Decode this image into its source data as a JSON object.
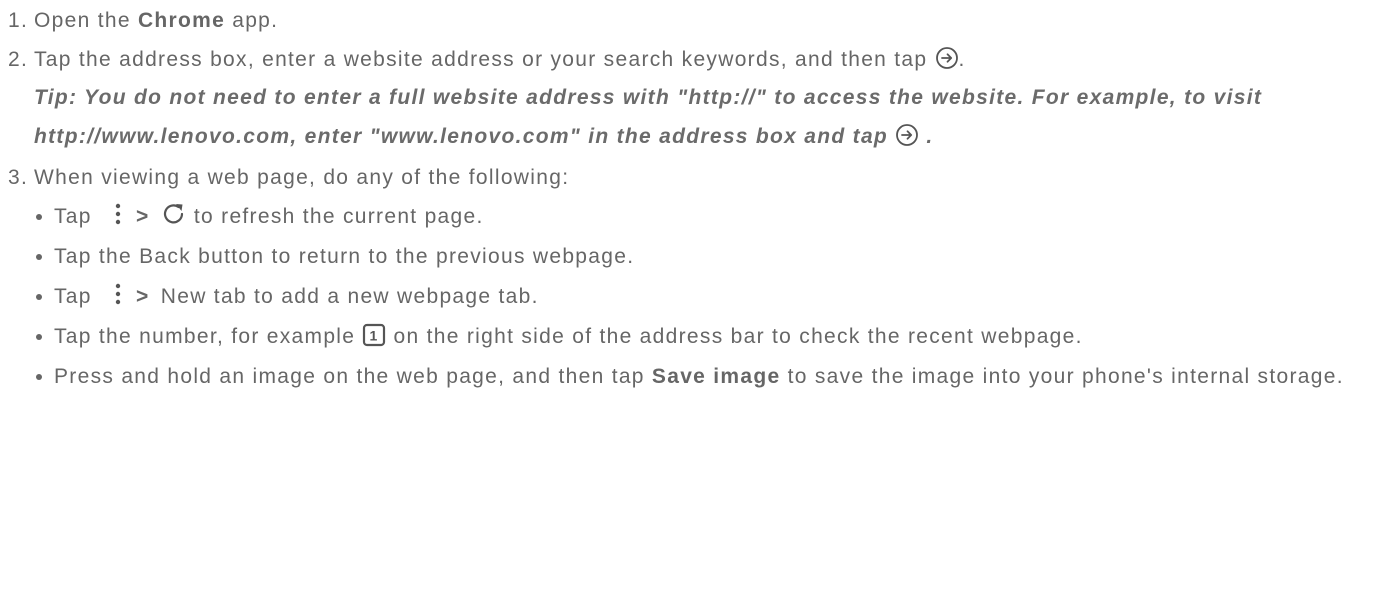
{
  "steps": [
    {
      "num": "1.",
      "pre": "Open the ",
      "bold": "Chrome",
      "post": " app."
    },
    {
      "num": "2.",
      "pre": "Tap the address box, enter a website address or your search keywords, and then tap",
      "post": "."
    },
    {
      "num": "3.",
      "text": "When viewing a web page, do any of the following:"
    }
  ],
  "tip": {
    "text": "Tip: You do not need to enter a full website address with \"http://\" to access the website. For example, to visit http://www.lenovo.com, enter \"www.lenovo.com\" in the address box and tap",
    "end": " ."
  },
  "bullets": {
    "refresh": {
      "pre": "Tap",
      "sep": ">",
      "post": "to refresh the current page."
    },
    "back": {
      "text": "Tap the Back button to return to the previous webpage."
    },
    "newtab": {
      "pre": "Tap",
      "sep": ">",
      "post": "New tab to add a new webpage tab."
    },
    "tabs": {
      "pre": "Tap the number, for example",
      "badge": "1",
      "post": "on the right side of the address bar to check the recent webpage."
    },
    "save": {
      "pre": "Press and hold an image on the web page, and then tap ",
      "bold": "Save image",
      "post": " to save the image into your phone's internal storage."
    }
  },
  "icons": [
    "go-arrow-icon",
    "more-vert-icon",
    "refresh-icon",
    "tab-count-icon"
  ],
  "colors": {
    "text": "#666666"
  }
}
